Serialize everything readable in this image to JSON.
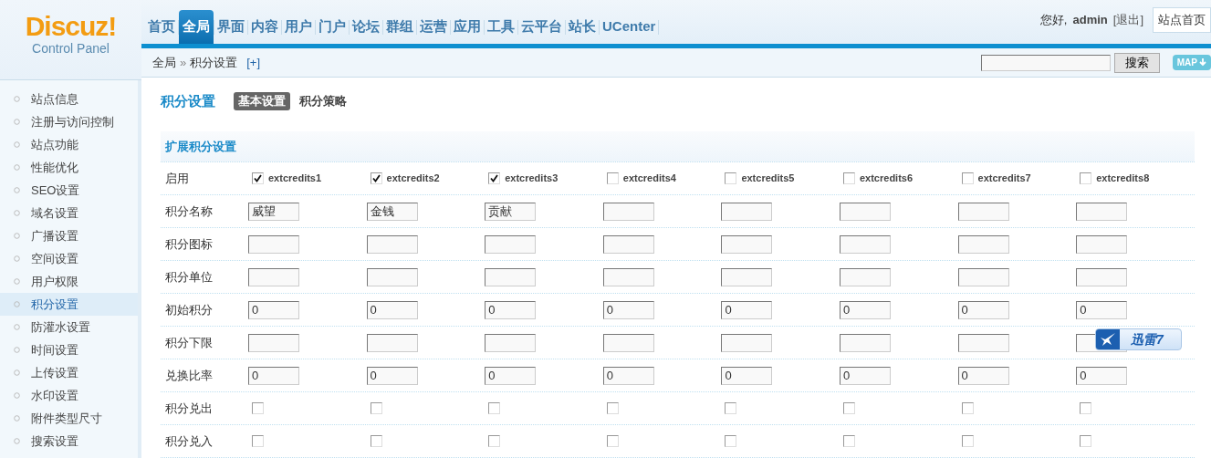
{
  "logo": {
    "title": "Discuz!",
    "subtitle": "Control Panel"
  },
  "nav": [
    {
      "label": "首页",
      "selected": false
    },
    {
      "label": "全局",
      "selected": true
    },
    {
      "label": "界面",
      "selected": false
    },
    {
      "label": "内容",
      "selected": false
    },
    {
      "label": "用户",
      "selected": false
    },
    {
      "label": "门户",
      "selected": false
    },
    {
      "label": "论坛",
      "selected": false
    },
    {
      "label": "群组",
      "selected": false
    },
    {
      "label": "运营",
      "selected": false
    },
    {
      "label": "应用",
      "selected": false
    },
    {
      "label": "工具",
      "selected": false
    },
    {
      "label": "云平台",
      "selected": false
    },
    {
      "label": "站长",
      "selected": false
    },
    {
      "label": "UCenter",
      "selected": false
    }
  ],
  "user": {
    "greeting": "您好,",
    "name": "admin",
    "logout": "[退出]",
    "site_home": "站点首页"
  },
  "breadcrumb": {
    "root": "全局",
    "separator": "»",
    "current": "积分设置",
    "add": "[+]"
  },
  "search": {
    "button": "搜索",
    "map": "MAP"
  },
  "sidebar": {
    "items": [
      {
        "label": "站点信息",
        "selected": false
      },
      {
        "label": "注册与访问控制",
        "selected": false
      },
      {
        "label": "站点功能",
        "selected": false
      },
      {
        "label": "性能优化",
        "selected": false
      },
      {
        "label": "SEO设置",
        "selected": false
      },
      {
        "label": "域名设置",
        "selected": false
      },
      {
        "label": "广播设置",
        "selected": false
      },
      {
        "label": "空间设置",
        "selected": false
      },
      {
        "label": "用户权限",
        "selected": false
      },
      {
        "label": "积分设置",
        "selected": true
      },
      {
        "label": "防灌水设置",
        "selected": false
      },
      {
        "label": "时间设置",
        "selected": false
      },
      {
        "label": "上传设置",
        "selected": false
      },
      {
        "label": "水印设置",
        "selected": false
      },
      {
        "label": "附件类型尺寸",
        "selected": false
      },
      {
        "label": "搜索设置",
        "selected": false
      }
    ]
  },
  "page": {
    "title": "积分设置",
    "tabs": [
      {
        "label": "基本设置",
        "selected": true
      },
      {
        "label": "积分策略",
        "selected": false
      }
    ]
  },
  "table": {
    "title": "扩展积分设置",
    "rows": [
      {
        "label": "启用",
        "kind": "enable",
        "cells": [
          {
            "text": "extcredits1",
            "checked": true
          },
          {
            "text": "extcredits2",
            "checked": true
          },
          {
            "text": "extcredits3",
            "checked": true
          },
          {
            "text": "extcredits4",
            "checked": false
          },
          {
            "text": "extcredits5",
            "checked": false
          },
          {
            "text": "extcredits6",
            "checked": false
          },
          {
            "text": "extcredits7",
            "checked": false
          },
          {
            "text": "extcredits8",
            "checked": false
          }
        ]
      },
      {
        "label": "积分名称",
        "kind": "input",
        "cells": [
          {
            "value": "威望"
          },
          {
            "value": "金钱"
          },
          {
            "value": "贡献"
          },
          {},
          {},
          {},
          {},
          {}
        ]
      },
      {
        "label": "积分图标",
        "kind": "input",
        "cells": [
          {},
          {},
          {},
          {},
          {},
          {},
          {},
          {}
        ]
      },
      {
        "label": "积分单位",
        "kind": "input",
        "cells": [
          {},
          {},
          {},
          {},
          {},
          {},
          {},
          {}
        ]
      },
      {
        "label": "初始积分",
        "kind": "input",
        "cells": [
          {
            "value": "0"
          },
          {
            "value": "0"
          },
          {
            "value": "0"
          },
          {
            "value": "0"
          },
          {
            "value": "0"
          },
          {
            "value": "0"
          },
          {
            "value": "0"
          },
          {
            "value": "0"
          }
        ]
      },
      {
        "label": "积分下限",
        "kind": "input",
        "cells": [
          {},
          {},
          {},
          {},
          {},
          {},
          {},
          {}
        ]
      },
      {
        "label": "兑换比率",
        "kind": "input",
        "cells": [
          {
            "value": "0"
          },
          {
            "value": "0"
          },
          {
            "value": "0"
          },
          {
            "value": "0"
          },
          {
            "value": "0"
          },
          {
            "value": "0"
          },
          {
            "value": "0"
          },
          {
            "value": "0"
          }
        ]
      },
      {
        "label": "积分兑出",
        "kind": "checkbox",
        "cells": [
          {
            "checked": false
          },
          {
            "checked": false
          },
          {
            "checked": false
          },
          {
            "checked": false
          },
          {
            "checked": false
          },
          {
            "checked": false
          },
          {
            "checked": false
          },
          {
            "checked": false
          }
        ]
      },
      {
        "label": "积分兑入",
        "kind": "checkbox",
        "cells": [
          {
            "checked": false
          },
          {
            "checked": false
          },
          {
            "checked": false
          },
          {
            "checked": false
          },
          {
            "checked": false
          },
          {
            "checked": false
          },
          {
            "checked": false
          },
          {
            "checked": false
          }
        ]
      }
    ]
  },
  "overlay_badge": {
    "label": "迅雷7"
  }
}
